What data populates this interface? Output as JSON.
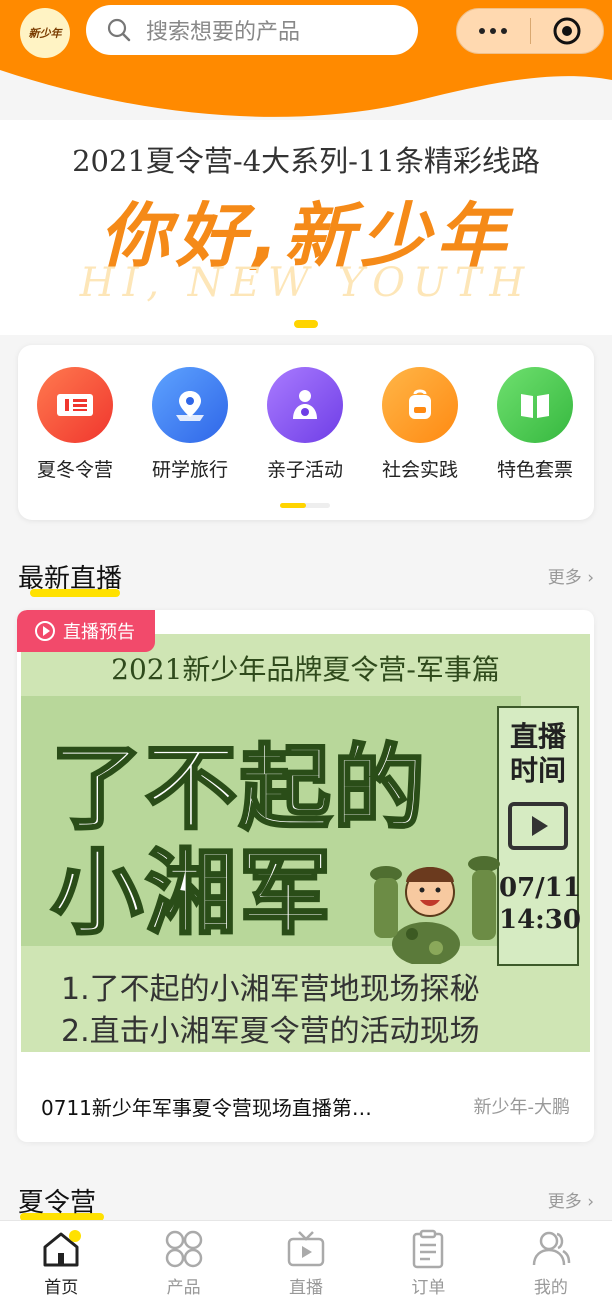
{
  "header": {
    "logo_text": "新少年",
    "search_placeholder": "搜索想要的产品",
    "capsule_menu_icon": "more-dots-icon",
    "capsule_close_icon": "target-icon"
  },
  "banner": {
    "subtitle": "2021夏令营-4大系列-11条精彩线路",
    "title": "你好,新少年",
    "english": "HI, NEW YOUTH"
  },
  "categories": [
    {
      "label": "夏冬令营",
      "icon": "ticket-icon",
      "color": "#f5563c"
    },
    {
      "label": "研学旅行",
      "icon": "map-pin-icon",
      "color": "#3d7cf5"
    },
    {
      "label": "亲子活动",
      "icon": "parent-child-icon",
      "color": "#8a56f0"
    },
    {
      "label": "社会实践",
      "icon": "backpack-icon",
      "color": "#ff9a1f"
    },
    {
      "label": "特色套票",
      "icon": "book-icon",
      "color": "#4fcf5a"
    }
  ],
  "live_section": {
    "title": "最新直播",
    "more": "更多"
  },
  "live_card": {
    "badge": "直播预告",
    "poster_heading": "2021新少年品牌夏令营-军事篇",
    "poster_big_1": "了不起的",
    "poster_big_2": "小湘军",
    "poster_time_label_1": "直播",
    "poster_time_label_2": "时间",
    "poster_date": "07/11",
    "poster_time": "14:30",
    "poster_line_1": "1.了不起的小湘军营地现场探秘",
    "poster_line_2": "2.直击小湘军夏令营的活动现场",
    "title": "0711新少年军事夏令营现场直播第…",
    "author": "新少年-大鹏"
  },
  "camp_section": {
    "title": "夏令营",
    "more": "更多"
  },
  "tabbar": [
    {
      "label": "首页",
      "icon": "home-icon",
      "active": true
    },
    {
      "label": "产品",
      "icon": "grid-icon",
      "active": false
    },
    {
      "label": "直播",
      "icon": "tv-play-icon",
      "active": false
    },
    {
      "label": "订单",
      "icon": "clipboard-icon",
      "active": false
    },
    {
      "label": "我的",
      "icon": "user-group-icon",
      "active": false
    }
  ],
  "colors": {
    "brand_orange": "#ff8a00",
    "highlight_yellow": "#ffe100",
    "live_badge": "#f24a6b"
  }
}
